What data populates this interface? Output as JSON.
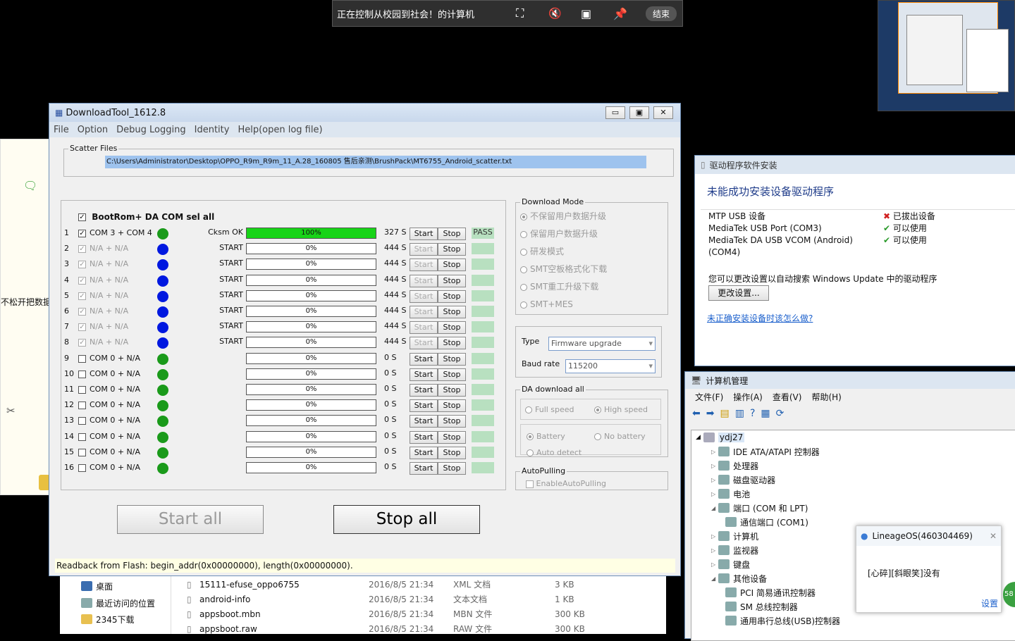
{
  "remote_bar": {
    "title": "正在控制从校园到社会！的计算机",
    "end": "结束"
  },
  "left_app": {
    "text": "不松开把数据"
  },
  "download_tool": {
    "title": "DownloadTool_1612.8",
    "menu": [
      "File",
      "Option",
      "Debug Logging",
      "Identity",
      "Help(open log file)"
    ],
    "scatter_label": "Scatter Files",
    "scatter_path": "C:\\Users\\Administrator\\Desktop\\OPPO_R9m_R9m_11_A.28_160805 售后亲测\\BrushPack\\MT6755_Android_scatter.txt",
    "sel_all_label": "BootRom+ DA COM sel all",
    "ports": [
      {
        "num": "1",
        "port": "COM 3 + COM 4",
        "color": "#1a9a1a",
        "status": "Cksm OK",
        "progress": "100%",
        "pct": 1,
        "time": "327 S",
        "result": "PASS",
        "checked": true,
        "enabled": true
      },
      {
        "num": "2",
        "port": "N/A + N/A",
        "color": "#0018e0",
        "status": "START",
        "progress": "0%",
        "pct": 0,
        "time": "444 S",
        "result": "",
        "checked": true,
        "enabled": false
      },
      {
        "num": "3",
        "port": "N/A + N/A",
        "color": "#0018e0",
        "status": "START",
        "progress": "0%",
        "pct": 0,
        "time": "444 S",
        "result": "",
        "checked": true,
        "enabled": false
      },
      {
        "num": "4",
        "port": "N/A + N/A",
        "color": "#0018e0",
        "status": "START",
        "progress": "0%",
        "pct": 0,
        "time": "444 S",
        "result": "",
        "checked": true,
        "enabled": false
      },
      {
        "num": "5",
        "port": "N/A + N/A",
        "color": "#0018e0",
        "status": "START",
        "progress": "0%",
        "pct": 0,
        "time": "444 S",
        "result": "",
        "checked": true,
        "enabled": false
      },
      {
        "num": "6",
        "port": "N/A + N/A",
        "color": "#0018e0",
        "status": "START",
        "progress": "0%",
        "pct": 0,
        "time": "444 S",
        "result": "",
        "checked": true,
        "enabled": false
      },
      {
        "num": "7",
        "port": "N/A + N/A",
        "color": "#0018e0",
        "status": "START",
        "progress": "0%",
        "pct": 0,
        "time": "444 S",
        "result": "",
        "checked": true,
        "enabled": false
      },
      {
        "num": "8",
        "port": "N/A + N/A",
        "color": "#0018e0",
        "status": "START",
        "progress": "0%",
        "pct": 0,
        "time": "444 S",
        "result": "",
        "checked": true,
        "enabled": false
      },
      {
        "num": "9",
        "port": "COM 0 + N/A",
        "color": "#1a9a1a",
        "status": "",
        "progress": "0%",
        "pct": 0,
        "time": "0 S",
        "result": "",
        "checked": false,
        "enabled": true
      },
      {
        "num": "10",
        "port": "COM 0 + N/A",
        "color": "#1a9a1a",
        "status": "",
        "progress": "0%",
        "pct": 0,
        "time": "0 S",
        "result": "",
        "checked": false,
        "enabled": true
      },
      {
        "num": "11",
        "port": "COM 0 + N/A",
        "color": "#1a9a1a",
        "status": "",
        "progress": "0%",
        "pct": 0,
        "time": "0 S",
        "result": "",
        "checked": false,
        "enabled": true
      },
      {
        "num": "12",
        "port": "COM 0 + N/A",
        "color": "#1a9a1a",
        "status": "",
        "progress": "0%",
        "pct": 0,
        "time": "0 S",
        "result": "",
        "checked": false,
        "enabled": true
      },
      {
        "num": "13",
        "port": "COM 0 + N/A",
        "color": "#1a9a1a",
        "status": "",
        "progress": "0%",
        "pct": 0,
        "time": "0 S",
        "result": "",
        "checked": false,
        "enabled": true
      },
      {
        "num": "14",
        "port": "COM 0 + N/A",
        "color": "#1a9a1a",
        "status": "",
        "progress": "0%",
        "pct": 0,
        "time": "0 S",
        "result": "",
        "checked": false,
        "enabled": true
      },
      {
        "num": "15",
        "port": "COM 0 + N/A",
        "color": "#1a9a1a",
        "status": "",
        "progress": "0%",
        "pct": 0,
        "time": "0 S",
        "result": "",
        "checked": false,
        "enabled": true
      },
      {
        "num": "16",
        "port": "COM 0 + N/A",
        "color": "#1a9a1a",
        "status": "",
        "progress": "0%",
        "pct": 0,
        "time": "0 S",
        "result": "",
        "checked": false,
        "enabled": true
      }
    ],
    "start_label": "Start",
    "stop_label": "Stop",
    "download_mode": {
      "label": "Download Mode",
      "options": [
        "不保留用户数据升级",
        "保留用户数据升级",
        "研发模式",
        "SMT空板格式化下载",
        "SMT重工升级下载",
        "SMT+MES"
      ]
    },
    "type_label": "Type",
    "type_value": "Firmware upgrade",
    "baud_label": "Baud rate",
    "baud_value": "115200",
    "da": {
      "label": "DA download all",
      "full": "Full speed",
      "high": "High speed",
      "battery": "Battery",
      "no_battery": "No battery",
      "auto": "Auto detect"
    },
    "autopulling": {
      "label": "AutoPulling",
      "option": "EnableAutoPulling"
    },
    "start_all": "Start all",
    "stop_all": "Stop all",
    "status_bar": "Readback from Flash:  begin_addr(0x00000000), length(0x00000000)."
  },
  "files": {
    "nav": [
      "桌面",
      "最近访问的位置",
      "2345下载"
    ],
    "rows": [
      {
        "name": "15111-efuse_oppo6755",
        "date": "2016/8/5 21:34",
        "type": "XML 文档",
        "size": "3 KB"
      },
      {
        "name": "android-info",
        "date": "2016/8/5 21:34",
        "type": "文本文档",
        "size": "1 KB"
      },
      {
        "name": "appsboot.mbn",
        "date": "2016/8/5 21:34",
        "type": "MBN 文件",
        "size": "300 KB"
      },
      {
        "name": "appsboot.raw",
        "date": "2016/8/5 21:34",
        "type": "RAW 文件",
        "size": "300 KB"
      }
    ]
  },
  "driver": {
    "title": "驱动程序软件安装",
    "heading": "未能成功安装设备驱动程序",
    "devices": [
      {
        "name": "MTP USB 设备",
        "status": "已拔出设备",
        "ok": false
      },
      {
        "name": "MediaTek USB Port (COM3)",
        "status": "可以使用",
        "ok": true
      },
      {
        "name": "MediaTek DA USB VCOM (Android)",
        "status": "可以使用",
        "ok": true
      },
      {
        "name": "(COM4)",
        "status": "",
        "ok": true
      }
    ],
    "note": "您可以更改设置以自动搜索 Windows Update 中的驱动程序",
    "change_btn": "更改设置...",
    "link": "未正确安装设备时该怎么做?"
  },
  "mgmt": {
    "title": "计算机管理",
    "menu": [
      "文件(F)",
      "操作(A)",
      "查看(V)",
      "帮助(H)"
    ],
    "root": "ydj27",
    "items": [
      "IDE ATA/ATAPI 控制器",
      "处理器",
      "磁盘驱动器",
      "电池",
      "端口 (COM 和 LPT)",
      "通信端口 (COM1)",
      "计算机",
      "监视器",
      "键盘",
      "其他设备",
      "PCI 简易通讯控制器",
      "SM 总线控制器",
      "通用串行总线(USB)控制器"
    ]
  },
  "notify": {
    "title": "LineageOS(460304469)",
    "message": "[心碎][斜眼笑]没有",
    "settings": "设置",
    "badge": "58"
  }
}
